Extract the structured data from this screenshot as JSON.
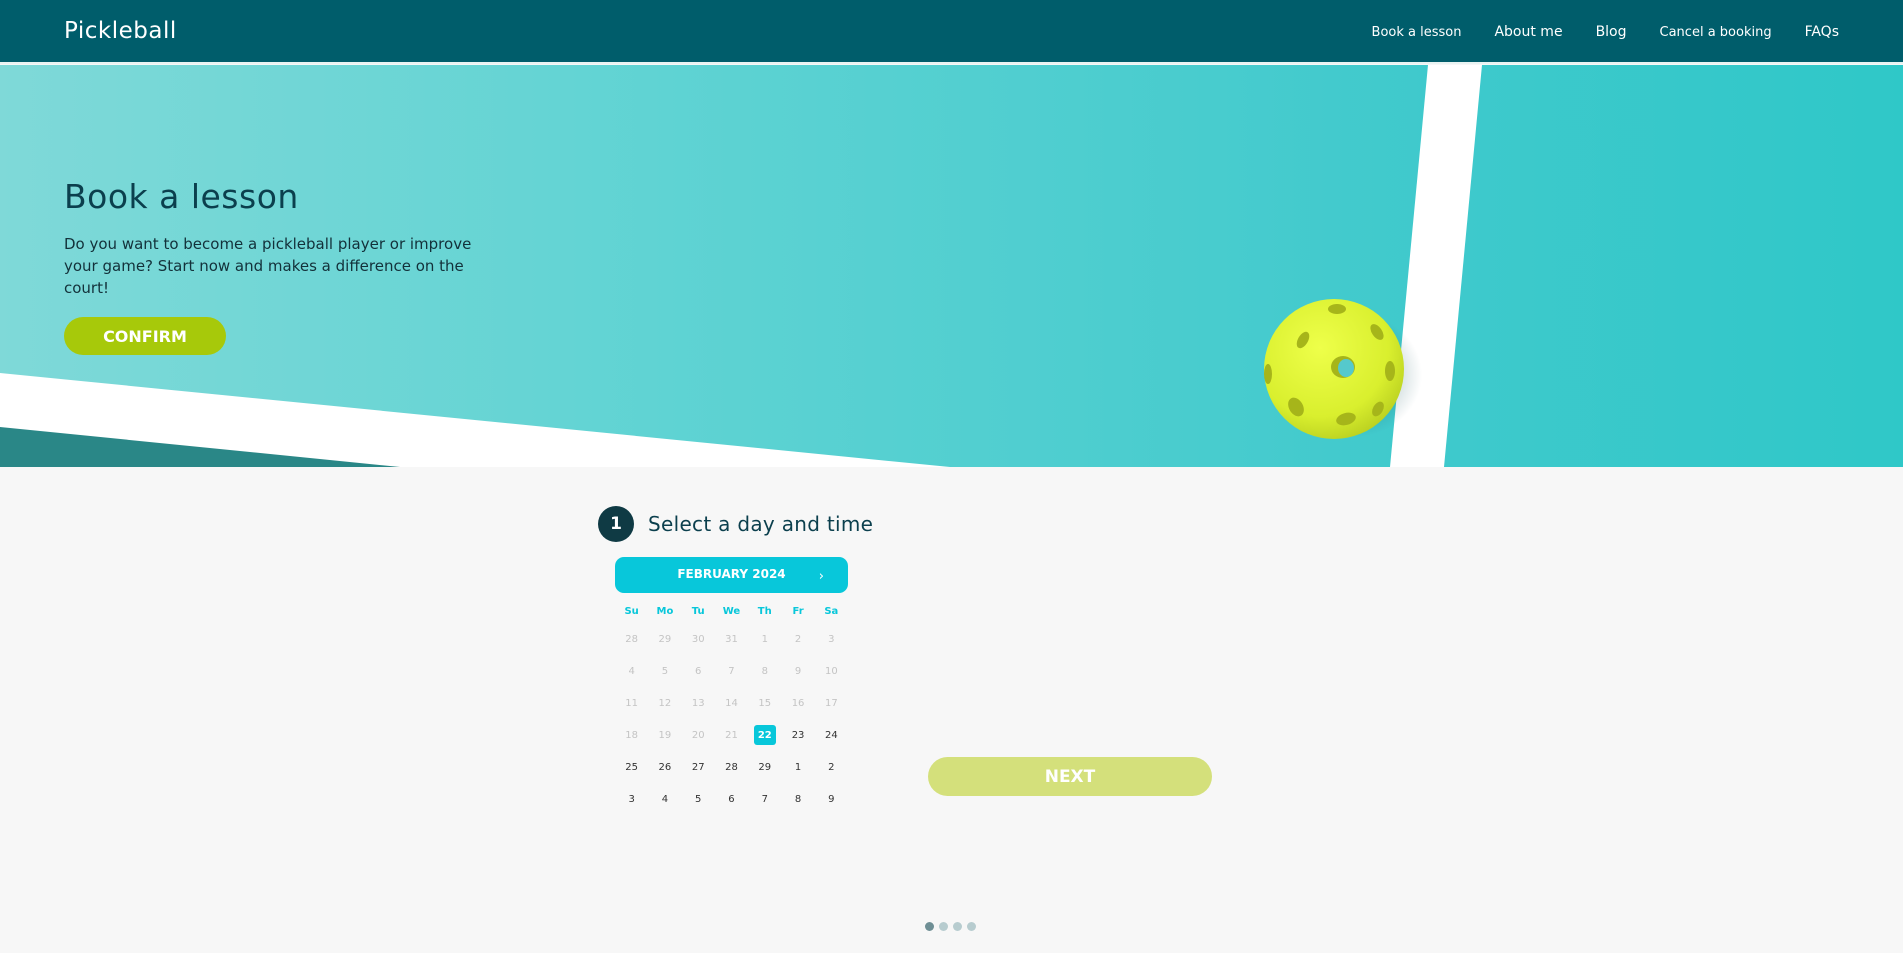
{
  "nav": {
    "logo": "Pickleball",
    "items": [
      "Book a lesson",
      "About me",
      "Blog",
      "Cancel a booking",
      "FAQs"
    ]
  },
  "hero": {
    "title": "Book a lesson",
    "text": "Do you want to become a pickleball player or improve your game? Start now and makes a difference on the court!",
    "confirm_label": "CONFIRM"
  },
  "booking": {
    "step_number": "1",
    "step_title": "Select a day and time",
    "next_label": "NEXT"
  },
  "calendar": {
    "month": "FEBRUARY 2024",
    "next_icon": "chevron-right-icon",
    "weekdays": [
      "Su",
      "Mo",
      "Tu",
      "We",
      "Th",
      "Fr",
      "Sa"
    ],
    "selected": "22",
    "days": [
      "28",
      "29",
      "30",
      "31",
      "1",
      "2",
      "3",
      "4",
      "5",
      "6",
      "7",
      "8",
      "9",
      "10",
      "11",
      "12",
      "13",
      "14",
      "15",
      "16",
      "17",
      "18",
      "19",
      "20",
      "21",
      "22",
      "23",
      "24",
      "25",
      "26",
      "27",
      "28",
      "29",
      "1",
      "2",
      "3",
      "4",
      "5",
      "6",
      "7",
      "8",
      "9"
    ],
    "disabled_count": 25
  },
  "pager": {
    "count": 4,
    "active": 0
  },
  "colors": {
    "nav": "#005d6b",
    "accent": "#08c7da",
    "confirm": "#a7c90a",
    "next": "#d4e07b",
    "ball": "#e2f53a"
  }
}
